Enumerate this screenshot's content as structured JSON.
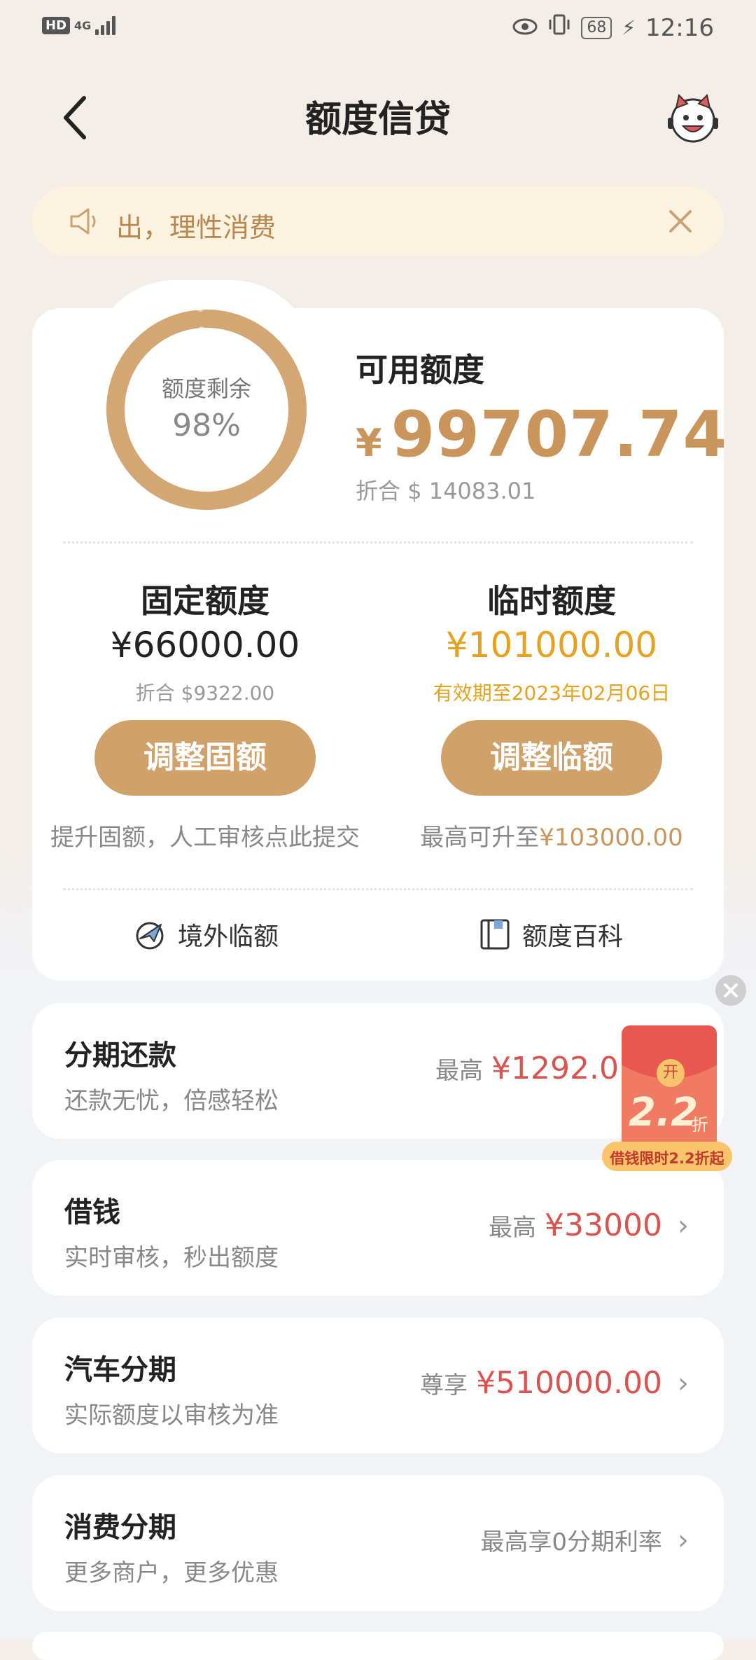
{
  "status_bar": {
    "hd": "HD",
    "network": "4G",
    "battery": "68",
    "time": "12:16"
  },
  "header": {
    "title": "额度信贷"
  },
  "notice": {
    "text": "出，理性消费"
  },
  "credit": {
    "ring_label": "额度剩余",
    "ring_percent": "98%",
    "remaining_fraction": 0.98,
    "available_title": "可用额度",
    "currency_symbol": "¥",
    "available_amount": "99707.74",
    "available_converted": "折合 $ 14083.01"
  },
  "fixed": {
    "title": "固定额度",
    "amount": "¥66000.00",
    "converted": "折合 $9322.00",
    "button": "调整固额",
    "hint": "提升固额，人工审核点此提交"
  },
  "temp": {
    "title": "临时额度",
    "amount": "¥101000.00",
    "validity": "有效期至2023年02月06日",
    "button": "调整临额",
    "hint_prefix": "最高可升至",
    "hint_amount": "¥103000.00"
  },
  "tools": {
    "overseas": "境外临额",
    "wiki": "额度百科"
  },
  "list": [
    {
      "title": "分期还款",
      "subtitle": "还款无忧，倍感轻松",
      "prefix": "最高",
      "amount": "¥1292.0"
    },
    {
      "title": "借钱",
      "subtitle": "实时审核，秒出额度",
      "prefix": "最高",
      "amount": "¥33000"
    },
    {
      "title": "汽车分期",
      "subtitle": "实际额度以审核为准",
      "prefix": "尊享",
      "amount": "¥510000.00"
    },
    {
      "title": "消费分期",
      "subtitle": "更多商户，更多优惠",
      "prefix": "最高享0分期利率",
      "amount": ""
    }
  ],
  "promo": {
    "badge": "开",
    "discount": "2.2",
    "unit": "折",
    "caption": "借钱限时2.2折起"
  },
  "colors": {
    "gold": "#C9955A",
    "button": "#D0A26A",
    "temp_amount": "#E6A21E",
    "red": "#D9534F",
    "notice_bg": "#FBF2DF"
  }
}
